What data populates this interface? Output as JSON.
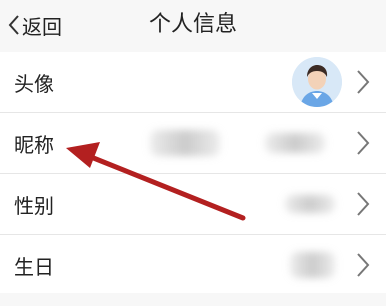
{
  "header": {
    "back_label": "返回",
    "title": "个人信息"
  },
  "rows": [
    {
      "label": "头像"
    },
    {
      "label": "昵称"
    },
    {
      "label": "性别"
    },
    {
      "label": "生日"
    }
  ],
  "colors": {
    "annotation_arrow": "#b32020",
    "background": "#f7f7f7",
    "row_background": "#ffffff",
    "text": "#222222",
    "chevron": "#777777"
  },
  "icons": {
    "back": "chevron-left-icon",
    "row_action": "chevron-right-icon",
    "avatar": "user-avatar"
  }
}
